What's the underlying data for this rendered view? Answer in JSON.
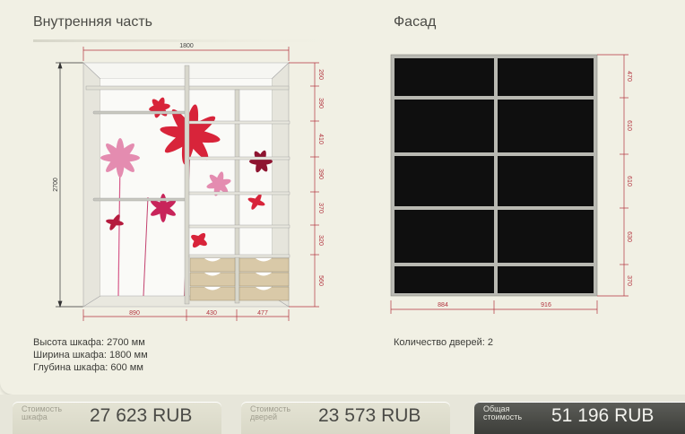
{
  "interior": {
    "title": "Внутренняя часть",
    "width_label": "1800",
    "height_label": "2700",
    "shelf_dims": [
      "260",
      "390",
      "410",
      "390",
      "370",
      "320",
      "560"
    ],
    "bottom_dims": [
      "890",
      "430",
      "477"
    ],
    "info_lines": [
      "Высота шкафа: 2700 мм",
      "Ширина шкафа: 1800 мм",
      "Глубина шкафа: 600 мм"
    ]
  },
  "facade": {
    "title": "Фасад",
    "row_dims": [
      "470",
      "610",
      "610",
      "630",
      "370"
    ],
    "bottom_dims": [
      "884",
      "916"
    ],
    "door_count_label": "Количество дверей: 2",
    "panel_color": "#0f0f0f",
    "frame_color": "#b9b9b2"
  },
  "footer": {
    "cabinet": {
      "label": "Стоимость шкафа",
      "value": "27 623  RUB"
    },
    "doors": {
      "label": "Стоимость дверей",
      "value": "23 573  RUB"
    },
    "total": {
      "label": "Общая стоимость",
      "value": "51 196  RUB"
    }
  },
  "colors": {
    "dimension": "#b2333e",
    "accent_flower_red": "#d8243a",
    "accent_flower_pink": "#e48cb0"
  }
}
